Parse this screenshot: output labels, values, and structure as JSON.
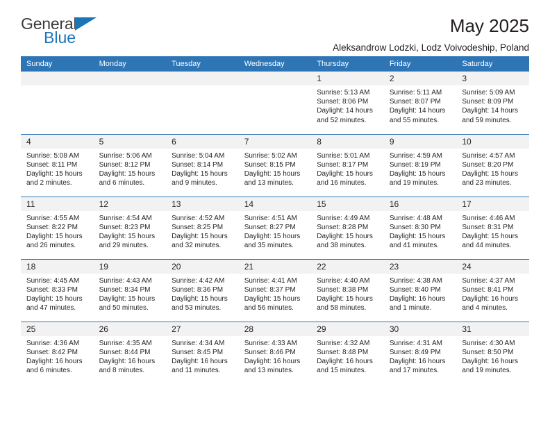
{
  "brand": {
    "name_top": "General",
    "name_bottom": "Blue",
    "triangle_icon": "blue-triangle-icon",
    "color_primary": "#1b75bb",
    "color_text": "#3b3b3b"
  },
  "header": {
    "title": "May 2025",
    "subtitle": "Aleksandrow Lodzki, Lodz Voivodeship, Poland"
  },
  "theme": {
    "header_bg": "#2e75b6",
    "header_text": "#ffffff",
    "daynum_bg": "#f2f2f2",
    "row_border": "#2e75b6",
    "body_text": "#231f20"
  },
  "weekdays": [
    "Sunday",
    "Monday",
    "Tuesday",
    "Wednesday",
    "Thursday",
    "Friday",
    "Saturday"
  ],
  "labels": {
    "sunrise_prefix": "Sunrise:",
    "sunset_prefix": "Sunset:",
    "daylight_prefix": "Daylight:"
  },
  "weeks": [
    [
      {
        "day": "",
        "sunrise": "",
        "sunset": "",
        "daylight_line1": "",
        "daylight_line2": "",
        "empty": true
      },
      {
        "day": "",
        "sunrise": "",
        "sunset": "",
        "daylight_line1": "",
        "daylight_line2": "",
        "empty": true
      },
      {
        "day": "",
        "sunrise": "",
        "sunset": "",
        "daylight_line1": "",
        "daylight_line2": "",
        "empty": true
      },
      {
        "day": "",
        "sunrise": "",
        "sunset": "",
        "daylight_line1": "",
        "daylight_line2": "",
        "empty": true
      },
      {
        "day": "1",
        "sunrise": "Sunrise: 5:13 AM",
        "sunset": "Sunset: 8:06 PM",
        "daylight_line1": "Daylight: 14 hours",
        "daylight_line2": "and 52 minutes."
      },
      {
        "day": "2",
        "sunrise": "Sunrise: 5:11 AM",
        "sunset": "Sunset: 8:07 PM",
        "daylight_line1": "Daylight: 14 hours",
        "daylight_line2": "and 55 minutes."
      },
      {
        "day": "3",
        "sunrise": "Sunrise: 5:09 AM",
        "sunset": "Sunset: 8:09 PM",
        "daylight_line1": "Daylight: 14 hours",
        "daylight_line2": "and 59 minutes."
      }
    ],
    [
      {
        "day": "4",
        "sunrise": "Sunrise: 5:08 AM",
        "sunset": "Sunset: 8:11 PM",
        "daylight_line1": "Daylight: 15 hours",
        "daylight_line2": "and 2 minutes."
      },
      {
        "day": "5",
        "sunrise": "Sunrise: 5:06 AM",
        "sunset": "Sunset: 8:12 PM",
        "daylight_line1": "Daylight: 15 hours",
        "daylight_line2": "and 6 minutes."
      },
      {
        "day": "6",
        "sunrise": "Sunrise: 5:04 AM",
        "sunset": "Sunset: 8:14 PM",
        "daylight_line1": "Daylight: 15 hours",
        "daylight_line2": "and 9 minutes."
      },
      {
        "day": "7",
        "sunrise": "Sunrise: 5:02 AM",
        "sunset": "Sunset: 8:15 PM",
        "daylight_line1": "Daylight: 15 hours",
        "daylight_line2": "and 13 minutes."
      },
      {
        "day": "8",
        "sunrise": "Sunrise: 5:01 AM",
        "sunset": "Sunset: 8:17 PM",
        "daylight_line1": "Daylight: 15 hours",
        "daylight_line2": "and 16 minutes."
      },
      {
        "day": "9",
        "sunrise": "Sunrise: 4:59 AM",
        "sunset": "Sunset: 8:19 PM",
        "daylight_line1": "Daylight: 15 hours",
        "daylight_line2": "and 19 minutes."
      },
      {
        "day": "10",
        "sunrise": "Sunrise: 4:57 AM",
        "sunset": "Sunset: 8:20 PM",
        "daylight_line1": "Daylight: 15 hours",
        "daylight_line2": "and 23 minutes."
      }
    ],
    [
      {
        "day": "11",
        "sunrise": "Sunrise: 4:55 AM",
        "sunset": "Sunset: 8:22 PM",
        "daylight_line1": "Daylight: 15 hours",
        "daylight_line2": "and 26 minutes."
      },
      {
        "day": "12",
        "sunrise": "Sunrise: 4:54 AM",
        "sunset": "Sunset: 8:23 PM",
        "daylight_line1": "Daylight: 15 hours",
        "daylight_line2": "and 29 minutes."
      },
      {
        "day": "13",
        "sunrise": "Sunrise: 4:52 AM",
        "sunset": "Sunset: 8:25 PM",
        "daylight_line1": "Daylight: 15 hours",
        "daylight_line2": "and 32 minutes."
      },
      {
        "day": "14",
        "sunrise": "Sunrise: 4:51 AM",
        "sunset": "Sunset: 8:27 PM",
        "daylight_line1": "Daylight: 15 hours",
        "daylight_line2": "and 35 minutes."
      },
      {
        "day": "15",
        "sunrise": "Sunrise: 4:49 AM",
        "sunset": "Sunset: 8:28 PM",
        "daylight_line1": "Daylight: 15 hours",
        "daylight_line2": "and 38 minutes."
      },
      {
        "day": "16",
        "sunrise": "Sunrise: 4:48 AM",
        "sunset": "Sunset: 8:30 PM",
        "daylight_line1": "Daylight: 15 hours",
        "daylight_line2": "and 41 minutes."
      },
      {
        "day": "17",
        "sunrise": "Sunrise: 4:46 AM",
        "sunset": "Sunset: 8:31 PM",
        "daylight_line1": "Daylight: 15 hours",
        "daylight_line2": "and 44 minutes."
      }
    ],
    [
      {
        "day": "18",
        "sunrise": "Sunrise: 4:45 AM",
        "sunset": "Sunset: 8:33 PM",
        "daylight_line1": "Daylight: 15 hours",
        "daylight_line2": "and 47 minutes."
      },
      {
        "day": "19",
        "sunrise": "Sunrise: 4:43 AM",
        "sunset": "Sunset: 8:34 PM",
        "daylight_line1": "Daylight: 15 hours",
        "daylight_line2": "and 50 minutes."
      },
      {
        "day": "20",
        "sunrise": "Sunrise: 4:42 AM",
        "sunset": "Sunset: 8:36 PM",
        "daylight_line1": "Daylight: 15 hours",
        "daylight_line2": "and 53 minutes."
      },
      {
        "day": "21",
        "sunrise": "Sunrise: 4:41 AM",
        "sunset": "Sunset: 8:37 PM",
        "daylight_line1": "Daylight: 15 hours",
        "daylight_line2": "and 56 minutes."
      },
      {
        "day": "22",
        "sunrise": "Sunrise: 4:40 AM",
        "sunset": "Sunset: 8:38 PM",
        "daylight_line1": "Daylight: 15 hours",
        "daylight_line2": "and 58 minutes."
      },
      {
        "day": "23",
        "sunrise": "Sunrise: 4:38 AM",
        "sunset": "Sunset: 8:40 PM",
        "daylight_line1": "Daylight: 16 hours",
        "daylight_line2": "and 1 minute."
      },
      {
        "day": "24",
        "sunrise": "Sunrise: 4:37 AM",
        "sunset": "Sunset: 8:41 PM",
        "daylight_line1": "Daylight: 16 hours",
        "daylight_line2": "and 4 minutes."
      }
    ],
    [
      {
        "day": "25",
        "sunrise": "Sunrise: 4:36 AM",
        "sunset": "Sunset: 8:42 PM",
        "daylight_line1": "Daylight: 16 hours",
        "daylight_line2": "and 6 minutes."
      },
      {
        "day": "26",
        "sunrise": "Sunrise: 4:35 AM",
        "sunset": "Sunset: 8:44 PM",
        "daylight_line1": "Daylight: 16 hours",
        "daylight_line2": "and 8 minutes."
      },
      {
        "day": "27",
        "sunrise": "Sunrise: 4:34 AM",
        "sunset": "Sunset: 8:45 PM",
        "daylight_line1": "Daylight: 16 hours",
        "daylight_line2": "and 11 minutes."
      },
      {
        "day": "28",
        "sunrise": "Sunrise: 4:33 AM",
        "sunset": "Sunset: 8:46 PM",
        "daylight_line1": "Daylight: 16 hours",
        "daylight_line2": "and 13 minutes."
      },
      {
        "day": "29",
        "sunrise": "Sunrise: 4:32 AM",
        "sunset": "Sunset: 8:48 PM",
        "daylight_line1": "Daylight: 16 hours",
        "daylight_line2": "and 15 minutes."
      },
      {
        "day": "30",
        "sunrise": "Sunrise: 4:31 AM",
        "sunset": "Sunset: 8:49 PM",
        "daylight_line1": "Daylight: 16 hours",
        "daylight_line2": "and 17 minutes."
      },
      {
        "day": "31",
        "sunrise": "Sunrise: 4:30 AM",
        "sunset": "Sunset: 8:50 PM",
        "daylight_line1": "Daylight: 16 hours",
        "daylight_line2": "and 19 minutes."
      }
    ]
  ]
}
